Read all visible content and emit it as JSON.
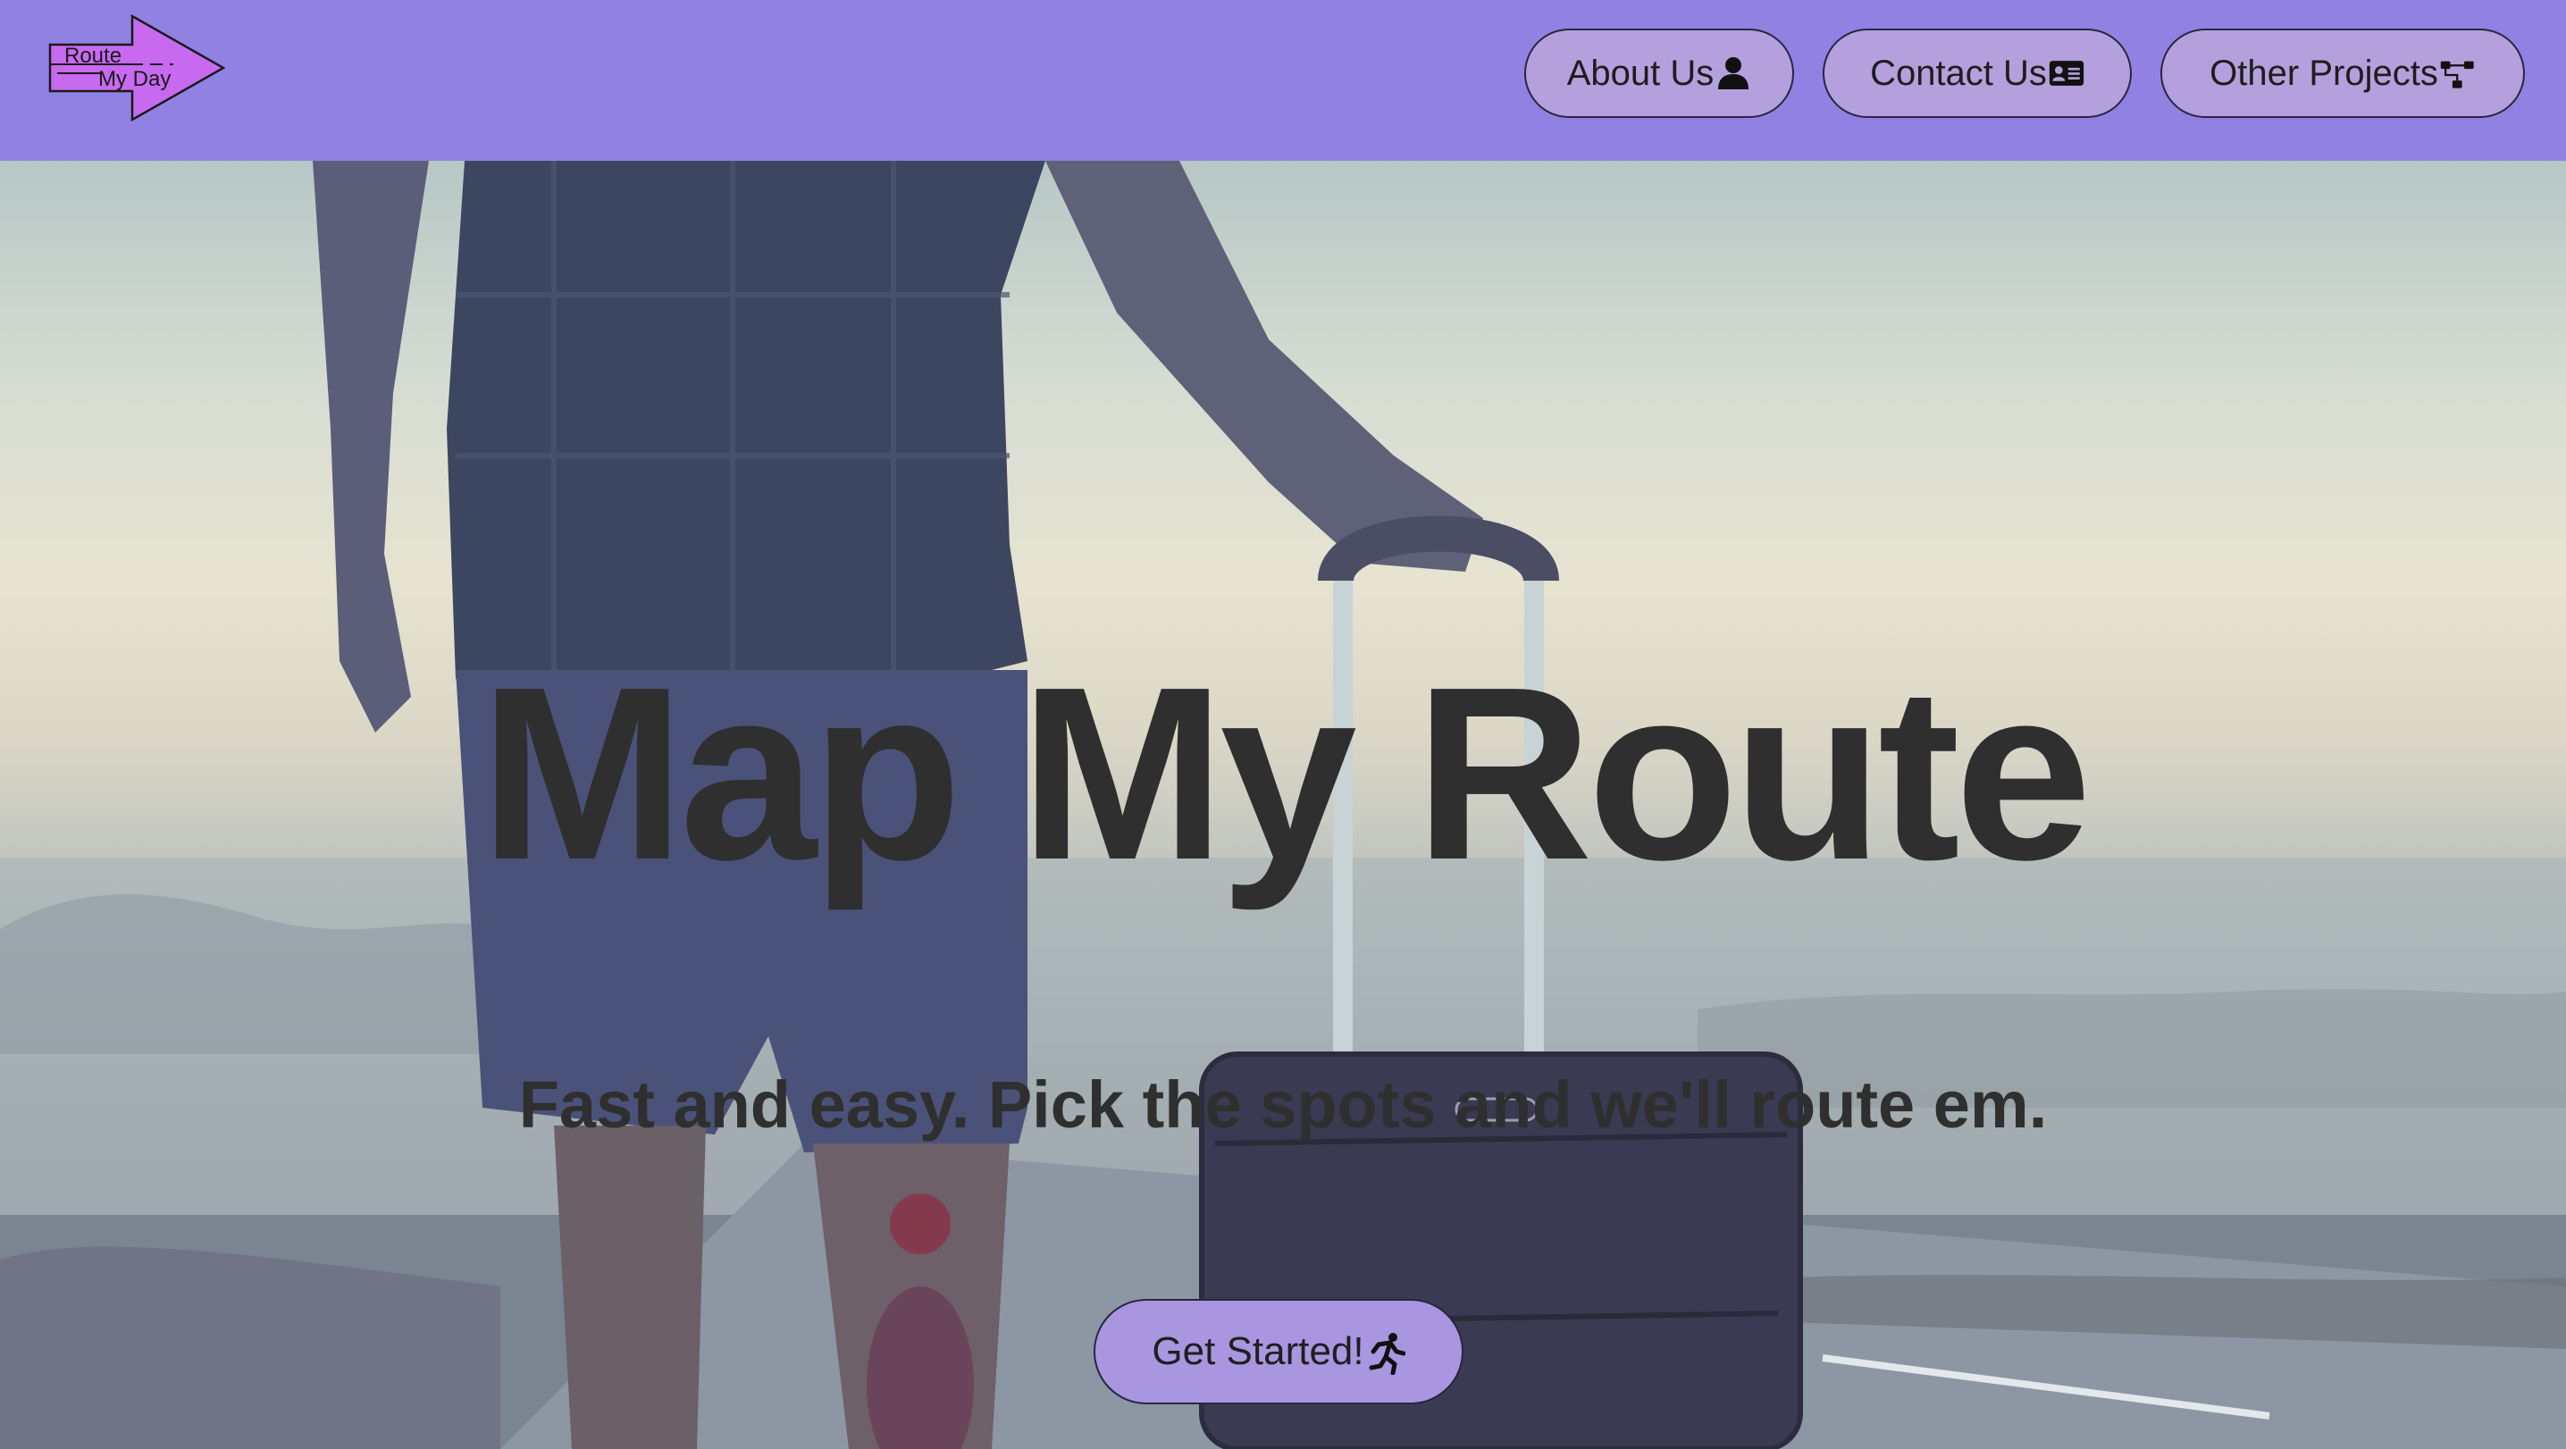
{
  "header": {
    "logo": {
      "line1": "Route",
      "line2": "My Day",
      "color": "#c86af0"
    },
    "background_color": "#9181e3",
    "nav": [
      {
        "label": "About Us",
        "icon": "user-icon"
      },
      {
        "label": "Contact Us",
        "icon": "id-card-icon"
      },
      {
        "label": "Other Projects",
        "icon": "sitemap-icon"
      }
    ]
  },
  "hero": {
    "title": "Map My Route",
    "subtitle": "Fast and easy. Pick the spots and we'll route em.",
    "cta": {
      "label": "Get Started!",
      "icon": "running-person-icon"
    },
    "background_image": "man-with-suitcase-on-foggy-road"
  }
}
